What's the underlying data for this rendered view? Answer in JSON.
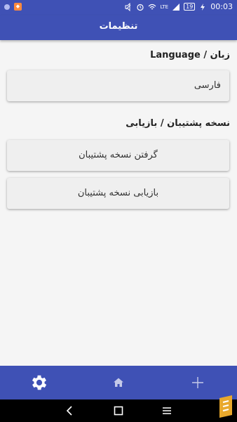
{
  "status_bar": {
    "battery": "19",
    "time": "00:03",
    "network_label": "LTE",
    "notification_icons": [
      "app-dot-icon",
      "app-box-icon"
    ],
    "indicator_icons": [
      "mute-icon",
      "alarm-icon",
      "wifi-icon",
      "signal-icon",
      "battery-icon",
      "charging-icon"
    ]
  },
  "toolbar": {
    "title": "تنظیمات"
  },
  "language_section": {
    "title": "زبان / Language",
    "selected_language": "فارسی"
  },
  "backup_section": {
    "title": "نسخه پشتیبان / بازیابی",
    "backup_button": "گرفتن نسخه پشتیبان",
    "restore_button": "بازیابی نسخه پشتیبان"
  },
  "bottom_nav": {
    "items": [
      "gear-icon",
      "home-icon",
      "plus-icon"
    ],
    "active": "gear-icon"
  },
  "system_nav": {
    "items": [
      "back-icon",
      "home-square-icon",
      "recents-icon"
    ]
  },
  "colors": {
    "primary": "#3f51b5",
    "background": "#f5f5f5",
    "card": "#efefef",
    "watermark": "#e8a82c"
  }
}
